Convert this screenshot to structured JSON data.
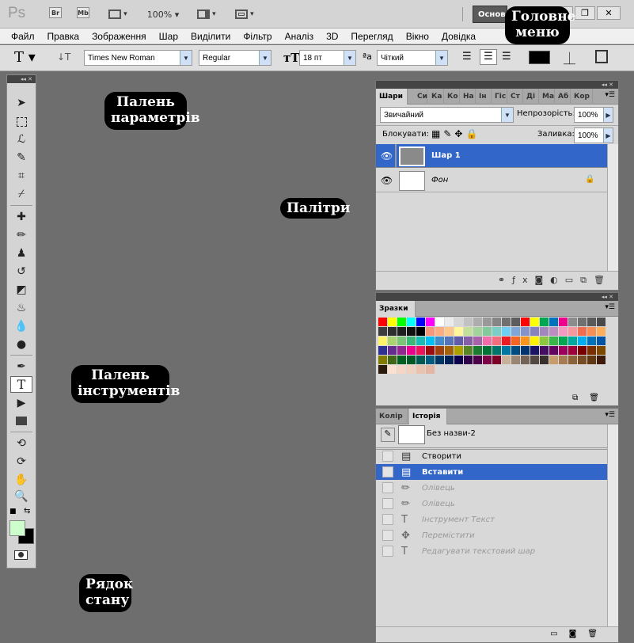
{
  "titlebar": {
    "logo": "Ps",
    "bridge": "Br",
    "minibridge": "Mb",
    "zoom": "100%",
    "workspace": "Основ",
    "minimize": "▬",
    "restore": "❐",
    "close": "✕"
  },
  "menu": [
    "Файл",
    "Правка",
    "Зображення",
    "Шар",
    "Виділити",
    "Фільтр",
    "Аналіз",
    "3D",
    "Перегляд",
    "Вікно",
    "Довідка"
  ],
  "options": {
    "font_family": "Times New Roman",
    "font_style": "Regular",
    "font_size": "18 пт",
    "antialias": "Чіткий",
    "antialias_glyph": "ªa"
  },
  "layers_panel": {
    "tabs": [
      "Шари",
      "Си",
      "Ка",
      "Ко",
      "На",
      "Ін",
      "Гіс",
      "Ст",
      "Ді",
      "Ма",
      "Аб",
      "Кор"
    ],
    "blend_mode": "Звичайний",
    "opacity_label": "Непрозорість:",
    "opacity": "100%",
    "lock_label": "Блокувати:",
    "fill_label": "Заливка:",
    "fill": "100%",
    "layers": [
      {
        "name": "Шар 1",
        "selected": true
      },
      {
        "name": "Фон",
        "selected": false,
        "locked": true
      }
    ]
  },
  "swatches_panel": {
    "tab": "Зразки",
    "colors": [
      "#ff0000",
      "#ffff00",
      "#00ff00",
      "#00ffff",
      "#0000ff",
      "#ff00ff",
      "#ffffff",
      "#ebebeb",
      "#d6d6d6",
      "#c2c2c2",
      "#adadad",
      "#999999",
      "#858585",
      "#707070",
      "#5c5c5c",
      "#ff0000",
      "#ffff00",
      "#00a651",
      "#0072bc",
      "#ec008c",
      "#8c8c8c",
      "#707070",
      "#595959",
      "#4a4a4a",
      "#3d3d3d",
      "#2e2e2e",
      "#1f1f1f",
      "#121212",
      "#000000",
      "#f7977a",
      "#f9ad81",
      "#fdc68a",
      "#fff79a",
      "#c4df9b",
      "#a2d39c",
      "#82ca9d",
      "#7bcdc8",
      "#6ecff6",
      "#7ea7d8",
      "#8493ca",
      "#8882be",
      "#a187be",
      "#bc8dbf",
      "#f49ac2",
      "#f6989d",
      "#f26c4f",
      "#f68e55",
      "#fbaf5c",
      "#fff467",
      "#acd372",
      "#7cc576",
      "#3bb878",
      "#1abbb4",
      "#00bff3",
      "#438ccb",
      "#5574b9",
      "#605ca8",
      "#855fa8",
      "#a763a8",
      "#f06eaa",
      "#f26d7d",
      "#ed1c24",
      "#f26522",
      "#f7941d",
      "#fff200",
      "#8dc73f",
      "#39b54a",
      "#00a651",
      "#00a99d",
      "#00aeef",
      "#0072bc",
      "#0054a6",
      "#2e3192",
      "#662d91",
      "#92278f",
      "#ec008c",
      "#ed145b",
      "#9e0b0f",
      "#a0410d",
      "#a36209",
      "#aba000",
      "#598527",
      "#1a7b30",
      "#007236",
      "#00746b",
      "#0076a3",
      "#004b80",
      "#003471",
      "#1b1464",
      "#440e62",
      "#630460",
      "#9e005d",
      "#9e0039",
      "#790000",
      "#7b2e00",
      "#7d4900",
      "#827b00",
      "#406618",
      "#005e20",
      "#005826",
      "#005952",
      "#005b7f",
      "#003663",
      "#002157",
      "#0d004c",
      "#32004b",
      "#4b0049",
      "#7b0046",
      "#7a0026",
      "#c7b299",
      "#998675",
      "#736357",
      "#534741",
      "#37302d",
      "#c69c6d",
      "#a67c52",
      "#8c6239",
      "#754c24",
      "#603913",
      "#3d1a0a",
      "#2b1b0d",
      "#f9e0d0",
      "#f5d6c6",
      "#f0d0c0",
      "#eac2b0",
      "#e2b6a2"
    ]
  },
  "history_panel": {
    "tabs": [
      "Колір",
      "Історія"
    ],
    "snapshot": "Без назви-2",
    "steps": [
      {
        "label": "Створити",
        "state": "normal",
        "icon": "document-icon"
      },
      {
        "label": "Вставити",
        "state": "selected",
        "icon": "document-icon"
      },
      {
        "label": "Олівець",
        "state": "dim",
        "icon": "pencil-icon"
      },
      {
        "label": "Олівець",
        "state": "dim",
        "icon": "pencil-icon"
      },
      {
        "label": "Інструмент Текст",
        "state": "dim",
        "icon": "type-icon"
      },
      {
        "label": "Перемістити",
        "state": "dim",
        "icon": "move-icon"
      },
      {
        "label": "Редагувати текстовий шар",
        "state": "dim",
        "icon": "type-icon"
      }
    ]
  },
  "callouts": {
    "main_menu": "Головне меню",
    "options_bar": "Палень параметрів",
    "palettes": "Палітри",
    "tools": "Палень інструментів",
    "status": "Рядок стану"
  },
  "colors": {
    "fg": "#000000",
    "bg": "#ccffcc",
    "selection": "#3266c8"
  }
}
